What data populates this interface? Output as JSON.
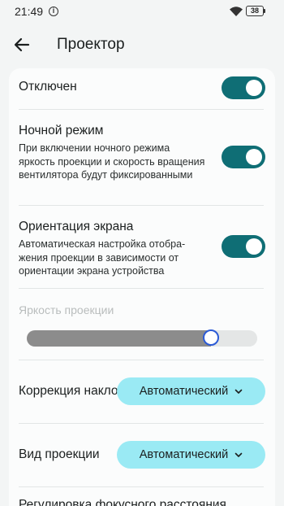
{
  "status_bar": {
    "time": "21:49",
    "info_icon": "i",
    "battery": "38"
  },
  "appbar": {
    "title": "Проектор"
  },
  "settings": {
    "disabled": {
      "title": "Отключен",
      "toggle_on": true
    },
    "night_mode": {
      "title": "Ночной режим",
      "description": "При включении ночного режима яркость проекции и скорость вращения вентилятора будут фиксированными",
      "toggle_on": true
    },
    "orientation": {
      "title": "Ориентация экрана",
      "description": "Автоматическая настройка отобра-жения проекции в зависимости от ориентации экрана устройства",
      "toggle_on": true
    },
    "brightness": {
      "label": "Яркость проекции",
      "level_percent": 80
    },
    "tilt_correction": {
      "label": "Коррекция наклона",
      "value": "Автоматический"
    },
    "projection_view": {
      "label": "Вид проекции",
      "value": "Автоматический"
    },
    "focus_row": {
      "label": "Регулировка фокусного расстояния"
    }
  },
  "colors": {
    "accent": "#0f6e75",
    "select_bg": "#9aeaf4",
    "slider_thumb_border": "#2c5bd6"
  }
}
